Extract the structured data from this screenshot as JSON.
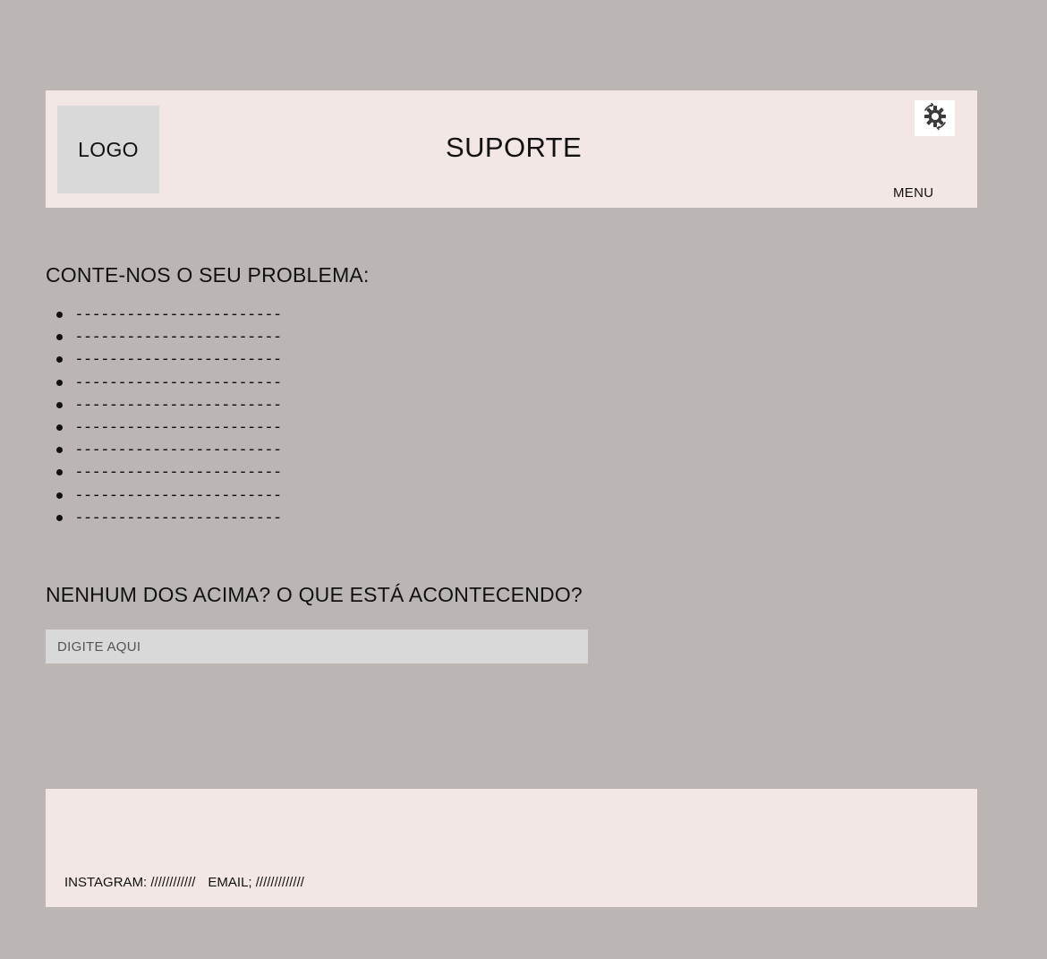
{
  "header": {
    "logo_text": "LOGO",
    "title": "SUPORTE",
    "menu_label": "MENU",
    "settings_icon": "gear-refresh-icon"
  },
  "problems": {
    "heading": "CONTE-NOS O SEU PROBLEMA:",
    "items": [
      "------------------------",
      "------------------------",
      "------------------------",
      "------------------------",
      "------------------------",
      "------------------------",
      "------------------------",
      "------------------------",
      "------------------------",
      "------------------------"
    ]
  },
  "other": {
    "heading": "NENHUM DOS ACIMA? O QUE ESTÁ ACONTECENDO?",
    "input_placeholder": "DIGITE AQUI",
    "input_value": ""
  },
  "footer": {
    "instagram": "INSTAGRAM: ////////////",
    "email": "EMAIL; /////////////"
  },
  "colors": {
    "background": "#bbb5b4",
    "panel": "#f3e7e5",
    "placeholder_box": "#d9d9d9"
  }
}
